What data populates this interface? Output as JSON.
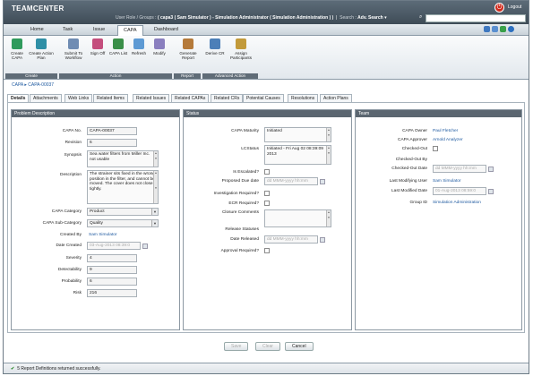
{
  "header": {
    "app_name": "TEAMCENTER",
    "user_role_label": "User Role / Groups",
    "user_role_value": "( capa3 ( Sam Simulator ) - Simulation Administrator ( Simulation Administration ) )",
    "search_label": "Search",
    "search_type": "Adv. Search",
    "search_value": "",
    "logout_label": "Logout"
  },
  "main_tabs": [
    "Home",
    "Task",
    "Issue",
    "CAPA",
    "Dashboard"
  ],
  "ribbon": {
    "buttons": [
      "Create CAPA",
      "Create Action Plan",
      "Submit To Workflow",
      "Sign Off",
      "CAPA List",
      "Refresh",
      "Modify",
      "Generate Report",
      "Derive CR",
      "Assign Participants"
    ],
    "groups": [
      "Create",
      "Action",
      "Report",
      "Advanced Action"
    ]
  },
  "breadcrumb": "CAPA ▸ CAPA-00037",
  "sub_tabs": [
    "Details",
    "Attachments",
    "Web Links",
    "Related Items",
    "Related Issues",
    "Related CAPAs",
    "Related CRs",
    "Potential Causes",
    "Resolutions",
    "Action Plans"
  ],
  "problem": {
    "title": "Problem Description",
    "capa_no_label": "CAPA No.",
    "capa_no": "CAPA-00037",
    "revision_label": "Revision",
    "revision": "6",
    "synopsis_label": "Synopsis",
    "synopsis": "Sea water filters from Miller Inc. not usable",
    "description_label": "Description",
    "description": "The strainer sits fixed in the wrong position in the filter, and cannot be moved. The cover does not close tightly.",
    "category_label": "CAPA Category",
    "category": "Product",
    "subcategory_label": "CAPA Sub-Category",
    "subcategory": "Quality",
    "created_by_label": "Created By",
    "created_by": "Sam Simulator",
    "date_created_label": "Date Created",
    "date_created": "03-Aug-2013 08:39:0",
    "severity_label": "Severity",
    "severity": "4",
    "detectability_label": "Detectability",
    "detectability": "9",
    "probability_label": "Probability",
    "probability": "6",
    "risk_label": "Risk",
    "risk": "216"
  },
  "status": {
    "title": "Status",
    "maturity_label": "CAPA Maturity",
    "maturity": "Initiated",
    "lcstatus_label": "LCStatus",
    "lcstatus": "Initiated - Fri Aug 02 08:39:09 2013",
    "escalated_label": "Is Escalated?",
    "proposed_due_label": "Proposed Due date",
    "proposed_due": "dd MMM-yyyy hh:mm",
    "investigation_label": "Investigation Required?",
    "ecr_label": "ECR Required?",
    "closure_label": "Closure Comments",
    "release_statuses_label": "Release Statuses",
    "date_released_label": "Date Released",
    "date_released": "dd MMM-yyyy hh:mm",
    "approval_label": "Approval Required?"
  },
  "team": {
    "title": "Team",
    "owner_label": "CAPA Owner",
    "owner": "Paul Fletcher",
    "approver_label": "CAPA Approver",
    "approver": "Arnold Analyzer",
    "checked_out_label": "Checked-Out",
    "checked_out_by_label": "Checked-Out By",
    "checked_out_date_label": "Checked-Out Date",
    "checked_out_date": "dd MMM-yyyy hh:mm",
    "last_modifying_label": "Last Modifying User",
    "last_modifying": "Sam Simulator",
    "last_modified_label": "Last Modified Date",
    "last_modified": "01-Aug-2013 08:59:0",
    "group_label": "Group ID",
    "group": "Simulation Administration"
  },
  "actions": {
    "save": "Save",
    "clear": "Clear",
    "cancel": "Cancel"
  },
  "status_bar": {
    "message": "5 Report Definitions returned successfully."
  },
  "colors": {
    "header": "#4b5965",
    "accent_red": "#cf2b1e",
    "link": "#1f5aa0",
    "panel_title": "#5b6670"
  }
}
